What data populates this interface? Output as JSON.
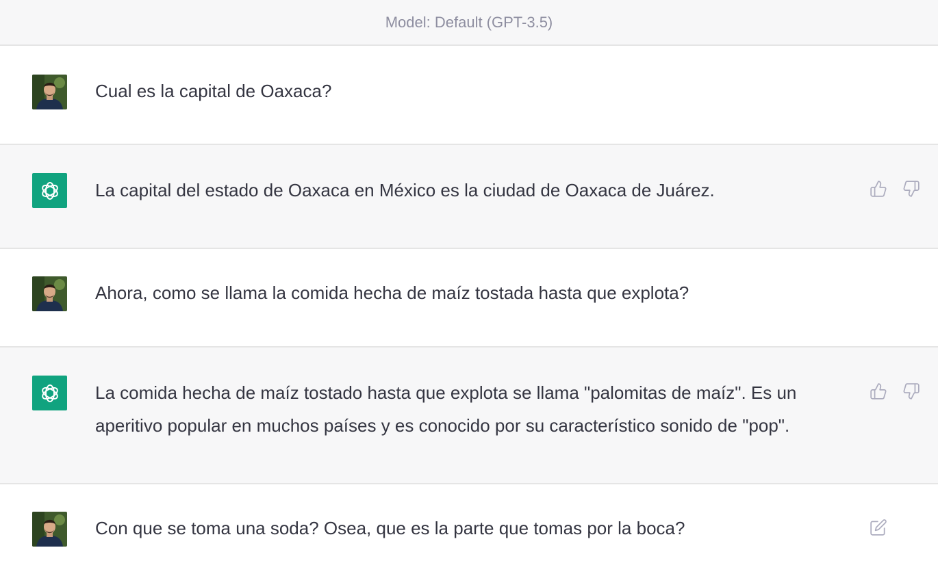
{
  "header": {
    "model_label": "Model: Default (GPT-3.5)"
  },
  "messages": [
    {
      "role": "user",
      "text": "Cual es la capital de Oaxaca?"
    },
    {
      "role": "assistant",
      "text": "La capital del estado de Oaxaca en México es la ciudad de Oaxaca de Juárez."
    },
    {
      "role": "user",
      "text": "Ahora, como se llama la comida hecha de maíz tostada hasta que explota?"
    },
    {
      "role": "assistant",
      "text": "La comida hecha de maíz tostado hasta que explota se llama \"palomitas de maíz\". Es un aperitivo popular en muchos países y es conocido por su característico sonido de \"pop\"."
    },
    {
      "role": "user",
      "text": "Con que se toma una soda? Osea, que es la parte que tomas por la boca?"
    }
  ],
  "icons": {
    "user_avatar": "user-avatar",
    "assistant_avatar": "openai-logo-icon",
    "like": "thumbs-up-icon",
    "dislike": "thumbs-down-icon",
    "edit": "edit-icon"
  },
  "colors": {
    "brand": "#10a37f",
    "text": "#343541",
    "muted": "#8e8ea0",
    "assistant_bg": "#f7f7f8"
  }
}
